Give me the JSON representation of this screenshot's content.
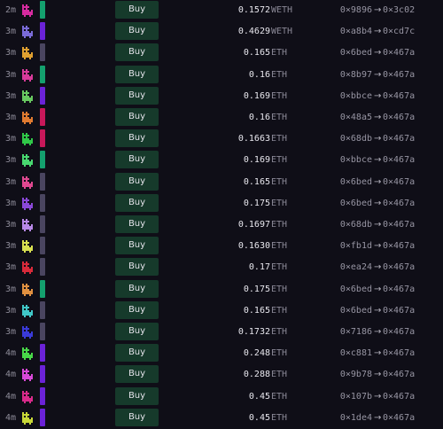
{
  "buy_label": "Buy",
  "arrow": "→",
  "colors": {
    "bar_green": "#14a06e",
    "bar_purple": "#6b22d8",
    "bar_gray": "#4a4560",
    "bar_red": "#c8185a"
  },
  "rows": [
    {
      "age": "2m",
      "avatar_color": "#d62ba0",
      "bar": "bar_green",
      "price": "0.1572",
      "unit": "WETH",
      "from": "0×9896",
      "to": "0×3c02"
    },
    {
      "age": "3m",
      "avatar_color": "#7a6bd8",
      "bar": "bar_purple",
      "price": "0.4629",
      "unit": "WETH",
      "from": "0×a8b4",
      "to": "0×cd7c"
    },
    {
      "age": "3m",
      "avatar_color": "#e0a030",
      "bar": "bar_gray",
      "price": "0.165",
      "unit": "ETH",
      "from": "0×6bed",
      "to": "0×467a"
    },
    {
      "age": "3m",
      "avatar_color": "#d83a9a",
      "bar": "bar_green",
      "price": "0.16",
      "unit": "ETH",
      "from": "0×8b97",
      "to": "0×467a"
    },
    {
      "age": "3m",
      "avatar_color": "#68c860",
      "bar": "bar_purple",
      "price": "0.169",
      "unit": "ETH",
      "from": "0×bbce",
      "to": "0×467a"
    },
    {
      "age": "3m",
      "avatar_color": "#e07a30",
      "bar": "bar_red",
      "price": "0.16",
      "unit": "ETH",
      "from": "0×48a5",
      "to": "0×467a"
    },
    {
      "age": "3m",
      "avatar_color": "#30c848",
      "bar": "bar_red",
      "price": "0.1663",
      "unit": "ETH",
      "from": "0×68db",
      "to": "0×467a"
    },
    {
      "age": "3m",
      "avatar_color": "#48d870",
      "bar": "bar_green",
      "price": "0.169",
      "unit": "ETH",
      "from": "0×bbce",
      "to": "0×467a"
    },
    {
      "age": "3m",
      "avatar_color": "#e04890",
      "bar": "bar_gray",
      "price": "0.165",
      "unit": "ETH",
      "from": "0×6bed",
      "to": "0×467a"
    },
    {
      "age": "3m",
      "avatar_color": "#8a48d8",
      "bar": "bar_gray",
      "price": "0.175",
      "unit": "ETH",
      "from": "0×6bed",
      "to": "0×467a"
    },
    {
      "age": "3m",
      "avatar_color": "#b888e8",
      "bar": "bar_gray",
      "price": "0.1697",
      "unit": "ETH",
      "from": "0×68db",
      "to": "0×467a"
    },
    {
      "age": "3m",
      "avatar_color": "#d8e050",
      "bar": "bar_gray",
      "price": "0.1630",
      "unit": "ETH",
      "from": "0×fb1d",
      "to": "0×467a"
    },
    {
      "age": "3m",
      "avatar_color": "#d82a3a",
      "bar": "bar_gray",
      "price": "0.17",
      "unit": "ETH",
      "from": "0×ea24",
      "to": "0×467a"
    },
    {
      "age": "3m",
      "avatar_color": "#e09040",
      "bar": "bar_green",
      "price": "0.175",
      "unit": "ETH",
      "from": "0×6bed",
      "to": "0×467a"
    },
    {
      "age": "3m",
      "avatar_color": "#40c8c8",
      "bar": "bar_gray",
      "price": "0.165",
      "unit": "ETH",
      "from": "0×6bed",
      "to": "0×467a"
    },
    {
      "age": "3m",
      "avatar_color": "#3a3ad8",
      "bar": "bar_gray",
      "price": "0.1732",
      "unit": "ETH",
      "from": "0×7186",
      "to": "0×467a"
    },
    {
      "age": "4m",
      "avatar_color": "#48d848",
      "bar": "bar_purple",
      "price": "0.248",
      "unit": "ETH",
      "from": "0×c881",
      "to": "0×467a"
    },
    {
      "age": "4m",
      "avatar_color": "#d848d8",
      "bar": "bar_purple",
      "price": "0.288",
      "unit": "ETH",
      "from": "0×9b78",
      "to": "0×467a"
    },
    {
      "age": "4m",
      "avatar_color": "#d82a8a",
      "bar": "bar_purple",
      "price": "0.45",
      "unit": "ETH",
      "from": "0×107b",
      "to": "0×467a"
    },
    {
      "age": "4m",
      "avatar_color": "#c8d838",
      "bar": "bar_purple",
      "price": "0.45",
      "unit": "ETH",
      "from": "0×1de4",
      "to": "0×467a"
    }
  ]
}
